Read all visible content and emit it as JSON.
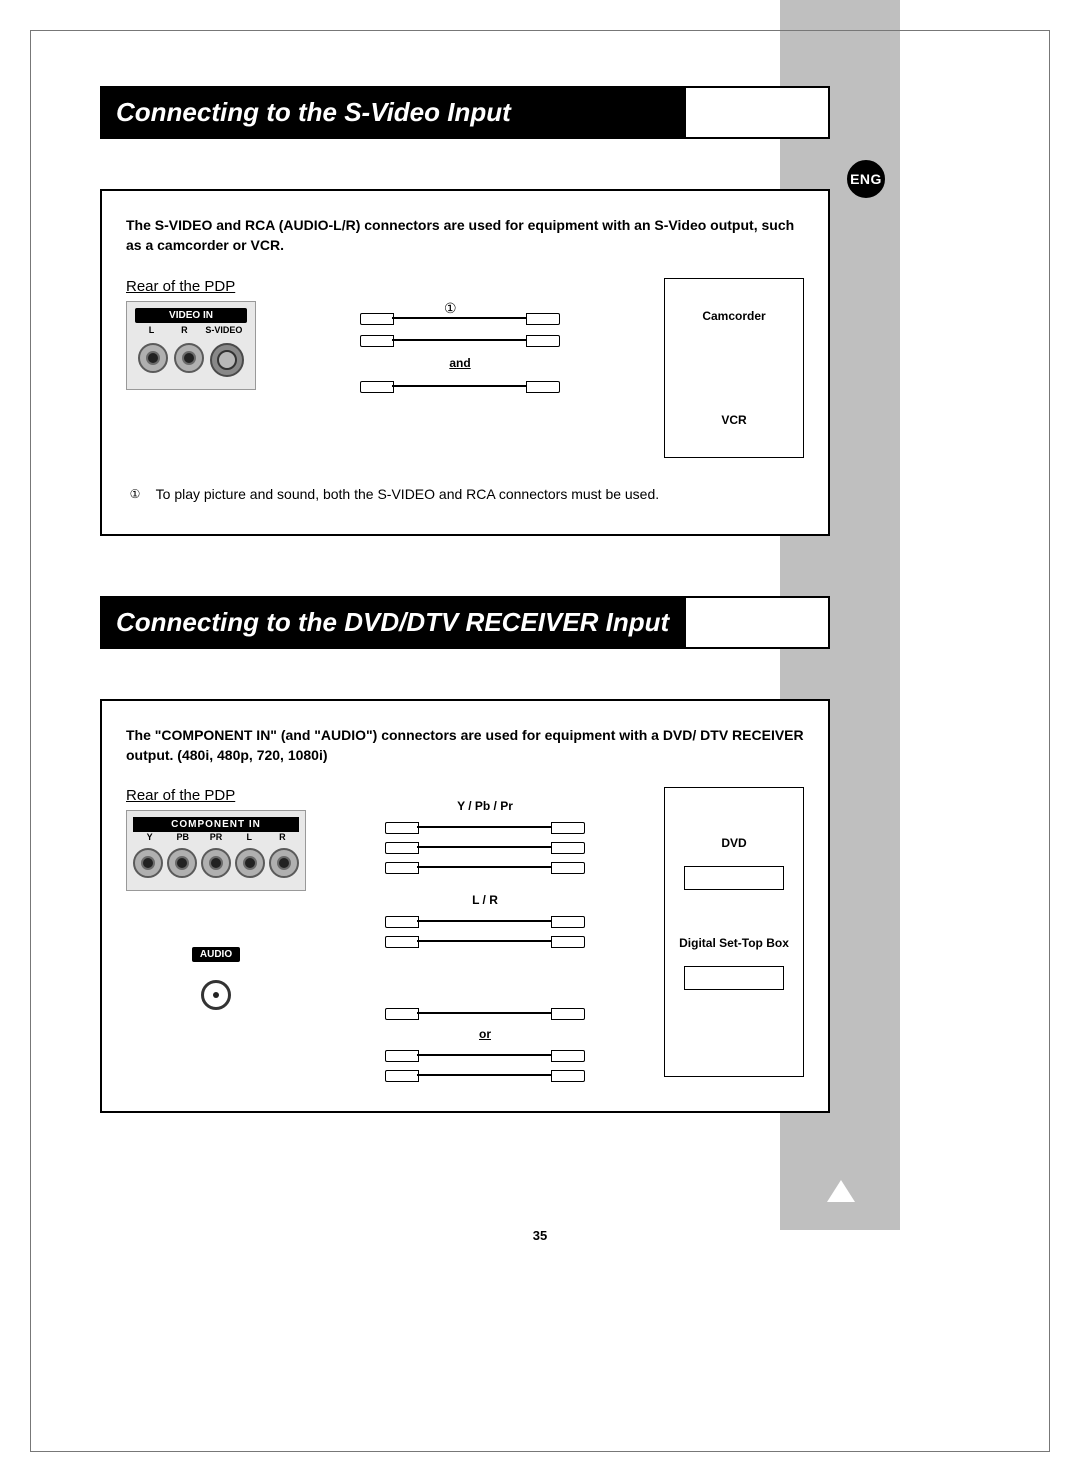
{
  "lang_badge": "ENG",
  "page_number": "35",
  "section1": {
    "title": "Connecting to the S-Video Input",
    "intro": "The S-VIDEO and RCA (AUDIO-L/R) connectors are used for equipment with an S-Video output, such as a camcorder or VCR.",
    "panel_label": "Rear of the PDP",
    "panel_header": "VIDEO IN",
    "jack_labels": {
      "l": "L",
      "r": "R",
      "svideo": "S-VIDEO"
    },
    "marker": "①",
    "and": "and",
    "devices": {
      "a": "Camcorder",
      "b": "VCR"
    },
    "note_marker": "①",
    "note_text": "To play picture and sound, both the S-VIDEO and RCA connectors must be used."
  },
  "section2": {
    "title": "Connecting to the DVD/DTV RECEIVER Input",
    "intro": "The \"COMPONENT IN\" (and \"AUDIO\") connectors are used for equipment with a DVD/ DTV RECEIVER output. (480i, 480p, 720, 1080i)",
    "panel_label": "Rear of the PDP",
    "panel_header": "COMPONENT  IN",
    "jack_labels": {
      "y": "Y",
      "pb": "PB",
      "pr": "PR",
      "l": "L",
      "r": "R"
    },
    "audio_header": "AUDIO",
    "cable_labels": {
      "ypbpr": "Y / Pb / Pr",
      "lr": "L / R"
    },
    "or": "or",
    "devices": {
      "a": "DVD",
      "b": "Digital Set-Top Box"
    }
  }
}
